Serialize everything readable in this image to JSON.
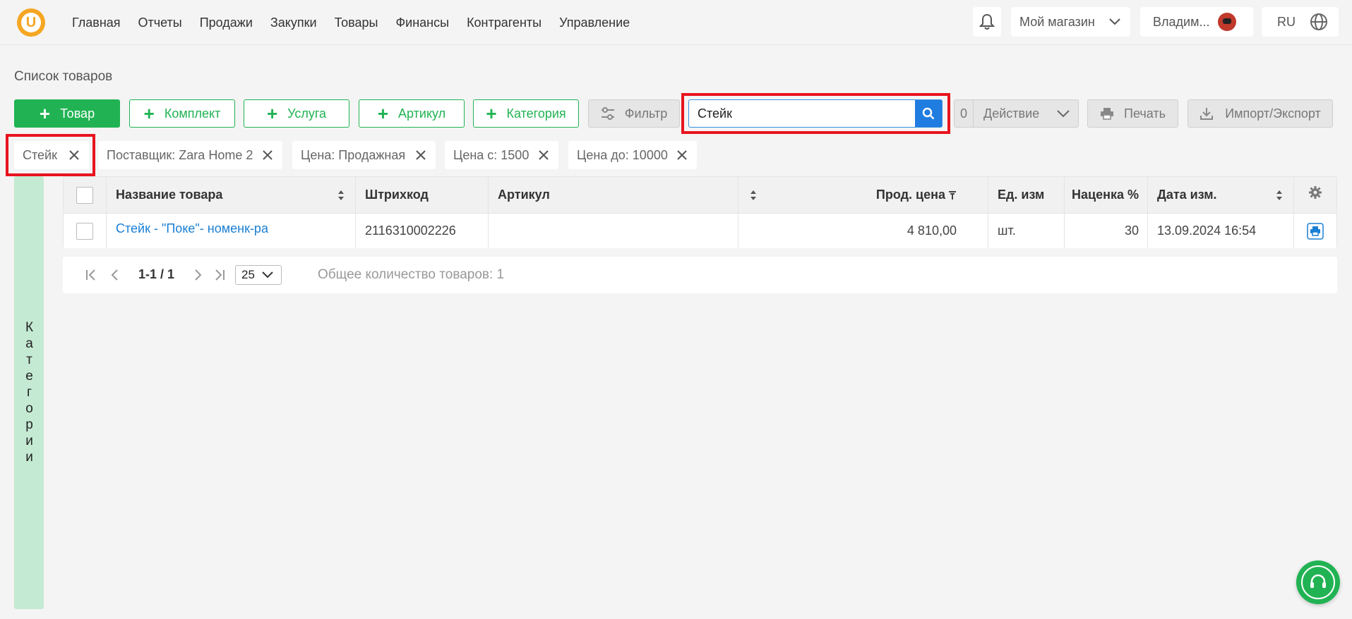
{
  "nav": {
    "logo_letter": "U",
    "items": [
      "Главная",
      "Отчеты",
      "Продажи",
      "Закупки",
      "Товары",
      "Финансы",
      "Контрагенты",
      "Управление"
    ],
    "store": "Мой магазин",
    "user": "Владим...",
    "lang": "RU"
  },
  "page": {
    "title": "Список товаров"
  },
  "toolbar": {
    "add_product": "Товар",
    "add_kit": "Комплект",
    "add_service": "Услуга",
    "add_article": "Артикул",
    "add_category": "Категория",
    "filter": "Фильтр",
    "search_value": "Стейк",
    "action_count": "0",
    "action": "Действие",
    "print": "Печать",
    "import_export": "Импорт/Экспорт"
  },
  "chips": [
    "Стейк",
    "Поставщик: Zara Home 2",
    "Цена: Продажная",
    "Цена с: 1500",
    "Цена до: 10000"
  ],
  "sidebar": {
    "categories_label": "Категории"
  },
  "table": {
    "headers": {
      "name": "Название товара",
      "barcode": "Штрихкод",
      "article": "Артикул",
      "sale_price": "Прод. цена",
      "unit": "Ед. изм",
      "markup": "Наценка %",
      "date": "Дата изм."
    },
    "rows": [
      {
        "name": "Стейк - \"Поке\"- номенк-ра",
        "barcode": "2116310002226",
        "article": "",
        "sale_price": "4 810,00",
        "unit": "шт.",
        "markup": "30",
        "date": "13.09.2024 16:54"
      }
    ]
  },
  "pagination": {
    "range": "1-1 / 1",
    "page_size": "25",
    "total": "Общее количество товаров: 1"
  },
  "colors": {
    "accent_green": "#21b353",
    "link_blue": "#1a7fd4",
    "highlight_red": "#e8141e",
    "search_blue": "#1f7ce0"
  }
}
